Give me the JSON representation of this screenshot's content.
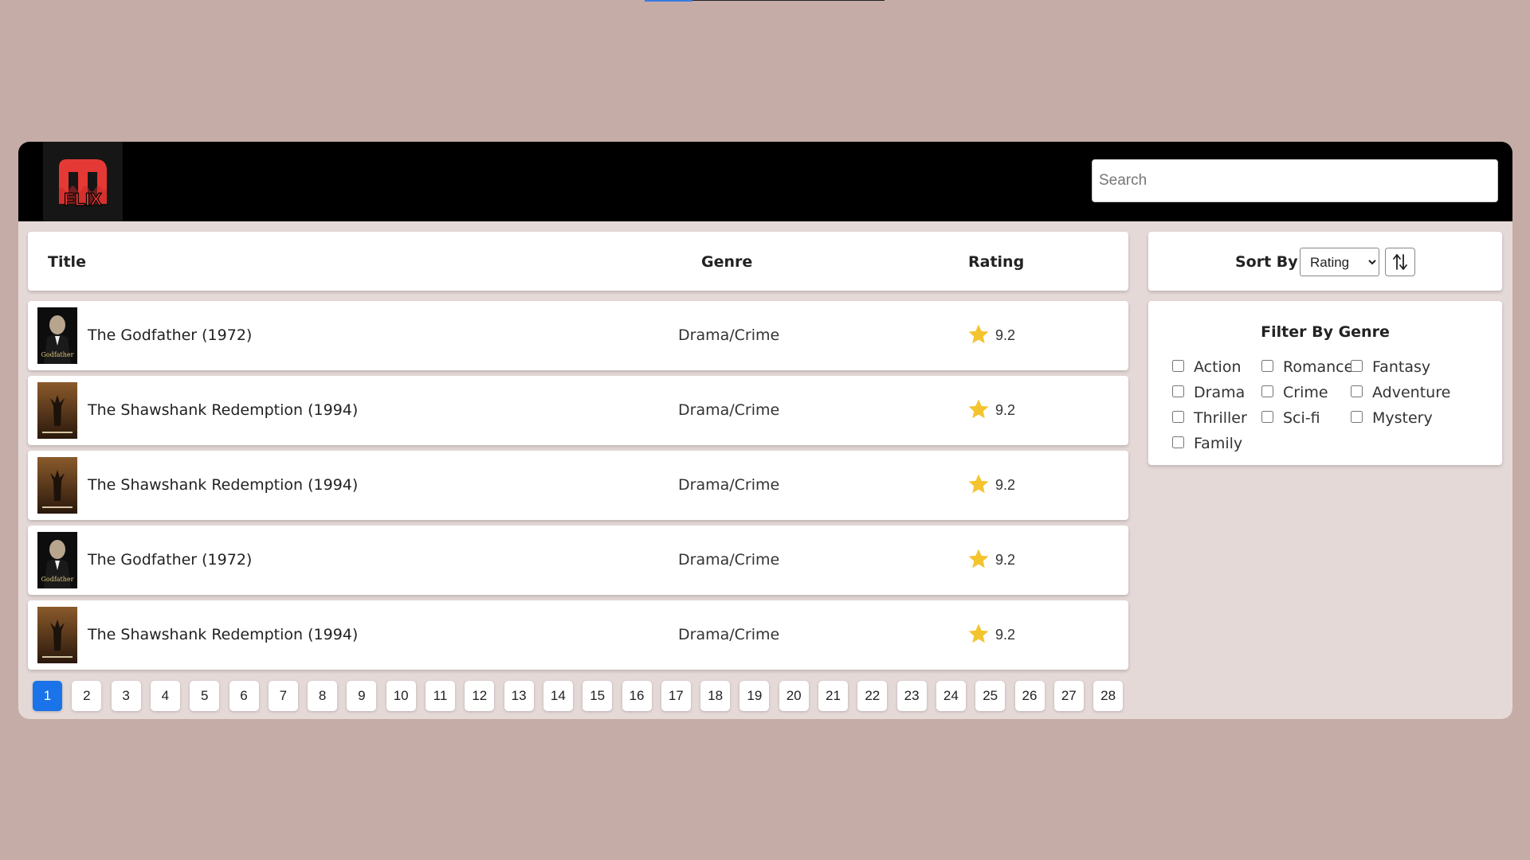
{
  "app": {
    "logo_text_top": "m",
    "logo_text_bottom": "FLIX",
    "brand_color": "#e53935"
  },
  "search": {
    "placeholder": "Search",
    "value": ""
  },
  "table": {
    "headers": {
      "title": "Title",
      "genre": "Genre",
      "rating": "Rating"
    },
    "rows": [
      {
        "title": "The Godfather (1972)",
        "genre": "Drama/Crime",
        "rating": "9.2",
        "poster": "godfather-poster"
      },
      {
        "title": "The Shawshank Redemption (1994)",
        "genre": "Drama/Crime",
        "rating": "9.2",
        "poster": "shawshank-poster"
      },
      {
        "title": "The Shawshank Redemption (1994)",
        "genre": "Drama/Crime",
        "rating": "9.2",
        "poster": "shawshank-poster"
      },
      {
        "title": "The Godfather (1972)",
        "genre": "Drama/Crime",
        "rating": "9.2",
        "poster": "godfather-poster"
      },
      {
        "title": "The Shawshank Redemption (1994)",
        "genre": "Drama/Crime",
        "rating": "9.2",
        "poster": "shawshank-poster"
      }
    ],
    "star_color": "#f4c430"
  },
  "pagination": {
    "pages": [
      "1",
      "2",
      "3",
      "4",
      "5",
      "6",
      "7",
      "8",
      "9",
      "10",
      "11",
      "12",
      "13",
      "14",
      "15",
      "16",
      "17",
      "18",
      "19",
      "20",
      "21",
      "22",
      "23",
      "24",
      "25",
      "26",
      "27",
      "28"
    ],
    "current": "1",
    "active_color": "#1a73e8"
  },
  "sort": {
    "label": "Sort By :",
    "selected": "Rating",
    "options": [
      "Rating"
    ],
    "toggle_icon": "sort-direction-icon"
  },
  "filter": {
    "title": "Filter By Genre",
    "genres": [
      {
        "label": "Action",
        "checked": false
      },
      {
        "label": "Romance",
        "checked": false
      },
      {
        "label": "Fantasy",
        "checked": false
      },
      {
        "label": "Drama",
        "checked": false
      },
      {
        "label": "Crime",
        "checked": false
      },
      {
        "label": "Adventure",
        "checked": false
      },
      {
        "label": "Thriller",
        "checked": false
      },
      {
        "label": "Sci-fi",
        "checked": false
      },
      {
        "label": "Mystery",
        "checked": false
      },
      {
        "label": "Family",
        "checked": false
      }
    ]
  }
}
